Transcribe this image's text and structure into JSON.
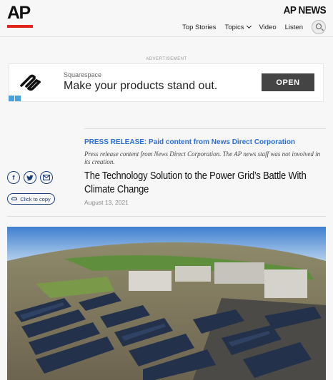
{
  "header": {
    "logo_text": "AP",
    "brand": "AP NEWS",
    "nav": [
      {
        "label": "Top Stories"
      },
      {
        "label": "Topics"
      },
      {
        "label": "Video"
      },
      {
        "label": "Listen"
      }
    ]
  },
  "ad": {
    "label": "ADVERTISEMENT",
    "brand": "Squarespace",
    "headline": "Make your products stand out.",
    "cta": "OPEN"
  },
  "article": {
    "press_release": "PRESS RELEASE: Paid content from News Direct Corporation",
    "disclaimer": "Press release content from News Direct Corporation. The AP news staff was not involved in its creation.",
    "title": "The Technology Solution to the Power Grid’s Battle With Climate Change",
    "date": "August 13, 2021",
    "copy_label": "Click to copy"
  },
  "colors": {
    "ap_red": "#e1251b",
    "press_blue": "#2a6fd6",
    "share_navy": "#1c3e7a"
  }
}
